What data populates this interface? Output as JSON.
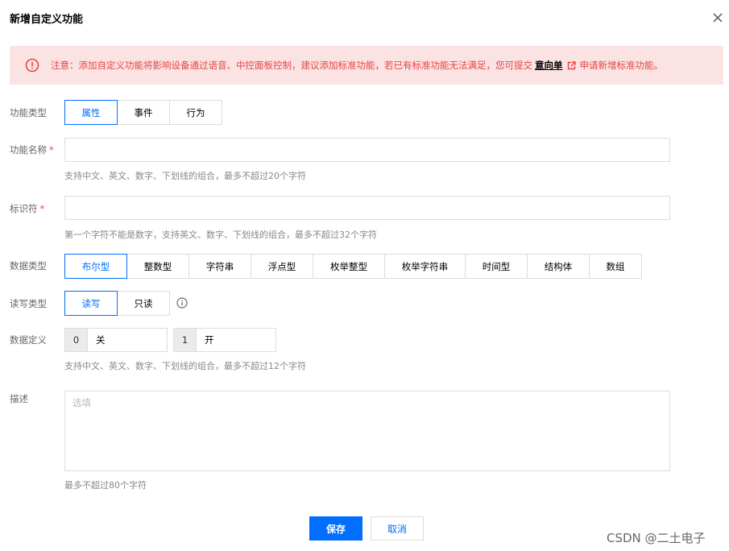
{
  "dialog": {
    "title": "新增自定义功能",
    "close_label": "×"
  },
  "alert": {
    "text_before": "注意：添加自定义功能将影响设备通过语音、中控面板控制，建议添加标准功能，若已有标准功能无法满足，您可提交",
    "link_text": "意向单",
    "text_after": "申请新增标准功能。",
    "color": "#e54545",
    "bg_color": "#fbe3e4"
  },
  "feature_type": {
    "label": "功能类型",
    "options": [
      "属性",
      "事件",
      "行为"
    ],
    "selected": "属性"
  },
  "feature_name": {
    "label": "功能名称",
    "required_mark": "*",
    "value": "",
    "help": "支持中文、英文、数字、下划线的组合，最多不超过20个字符"
  },
  "identifier": {
    "label": "标识符",
    "required_mark": "*",
    "value": "",
    "help": "第一个字符不能是数字，支持英文、数字、下划线的组合，最多不超过32个字符"
  },
  "data_type": {
    "label": "数据类型",
    "options": [
      "布尔型",
      "整数型",
      "字符串",
      "浮点型",
      "枚举整型",
      "枚举字符串",
      "时间型",
      "结构体",
      "数组"
    ],
    "selected": "布尔型"
  },
  "rw_type": {
    "label": "读写类型",
    "options": [
      "读写",
      "只读"
    ],
    "selected": "读写",
    "info_icon": "info-circle-icon"
  },
  "data_definition": {
    "label": "数据定义",
    "items": [
      {
        "key": "0",
        "value": "关"
      },
      {
        "key": "1",
        "value": "开"
      }
    ],
    "help": "支持中文、英文、数字、下划线的组合，最多不超过12个字符"
  },
  "description": {
    "label": "描述",
    "placeholder": "选填",
    "help": "最多不超过80个字符"
  },
  "actions": {
    "save": "保存",
    "cancel": "取消",
    "primary_color": "#006eff"
  },
  "watermark": "CSDN @二土电子"
}
